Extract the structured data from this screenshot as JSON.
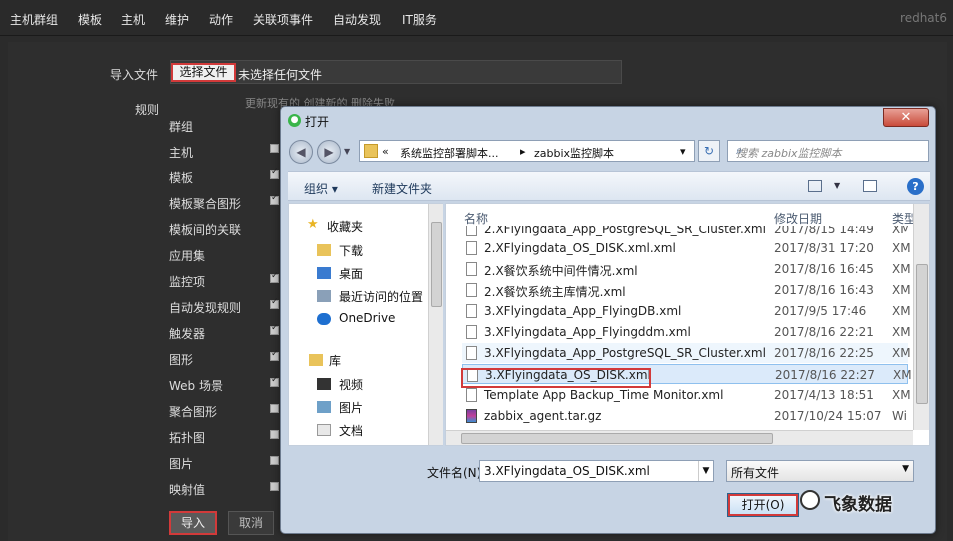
{
  "topnav": {
    "items": [
      "主机群组",
      "模板",
      "主机",
      "维护",
      "动作",
      "关联项事件",
      "自动发现",
      "IT服务"
    ],
    "user": "redhat6"
  },
  "form": {
    "import_file_label": "导入文件",
    "choose_file_button": "选择文件",
    "no_file_text": "未选择任何文件",
    "rules_label": "规则",
    "rules_header": "更新现有的 创建新的 删除失败",
    "rules": [
      {
        "label": "群组",
        "checked": false
      },
      {
        "label": "主机",
        "checked": false
      },
      {
        "label": "模板",
        "checked": true
      },
      {
        "label": "模板聚合图形",
        "checked": true
      },
      {
        "label": "模板间的关联",
        "checked": false
      },
      {
        "label": "应用集",
        "checked": false
      },
      {
        "label": "监控项",
        "checked": true
      },
      {
        "label": "自动发现规则",
        "checked": true
      },
      {
        "label": "触发器",
        "checked": true
      },
      {
        "label": "图形",
        "checked": true
      },
      {
        "label": "Web 场景",
        "checked": true
      },
      {
        "label": "聚合图形",
        "checked": false
      },
      {
        "label": "拓扑图",
        "checked": false
      },
      {
        "label": "图片",
        "checked": false
      },
      {
        "label": "映射值",
        "checked": false
      }
    ],
    "import_button": "导入",
    "cancel_button": "取消"
  },
  "dialog": {
    "title": "打开",
    "close_glyph": "✕",
    "address": {
      "prefix": "«",
      "segment1": "系统监控部署脚本...",
      "sep": "▸",
      "segment2": "zabbix监控脚本",
      "dropdown": "▾"
    },
    "search_placeholder": "搜索 zabbix监控脚本",
    "toolbar": {
      "organize": "组织 ▾",
      "new_folder": "新建文件夹"
    },
    "help_glyph": "?",
    "nav": {
      "favorites": "收藏夹",
      "items": [
        "下载",
        "桌面",
        "最近访问的位置",
        "OneDrive"
      ],
      "library": "库",
      "library_items": [
        "视频",
        "图片",
        "文档"
      ]
    },
    "columns": {
      "name": "名称",
      "modified": "修改日期",
      "type": "类型"
    },
    "files": [
      {
        "name": "2.XFlyingdata_App_PostgreSQL_SR_Cluster.xml",
        "date": "2017/8/15 14:49",
        "type": "XM"
      },
      {
        "name": "2.XFlyingdata_OS_DISK.xml.xml",
        "date": "2017/8/31 17:20",
        "type": "XM"
      },
      {
        "name": "2.X餐饮系统中间件情况.xml",
        "date": "2017/8/16 16:45",
        "type": "XM"
      },
      {
        "name": "2.X餐饮系统主库情况.xml",
        "date": "2017/8/16 16:43",
        "type": "XM"
      },
      {
        "name": "3.XFlyingdata_App_FlyingDB.xml",
        "date": "2017/9/5 17:46",
        "type": "XM"
      },
      {
        "name": "3.XFlyingdata_App_Flyingddm.xml",
        "date": "2017/8/16 22:21",
        "type": "XM"
      },
      {
        "name": "3.XFlyingdata_App_PostgreSQL_SR_Cluster.xml",
        "date": "2017/8/16 22:25",
        "type": "XM"
      },
      {
        "name": "3.XFlyingdata_OS_DISK.xml",
        "date": "2017/8/16 22:27",
        "type": "XM"
      },
      {
        "name": "Template App Backup_Time Monitor.xml",
        "date": "2017/4/13 18:51",
        "type": "XM"
      },
      {
        "name": "zabbix_agent.tar.gz",
        "date": "2017/10/24 15:07",
        "type": "Wi"
      }
    ],
    "filename_label": "文件名(N):",
    "filename_value": "3.XFlyingdata_OS_DISK.xml",
    "filetype_value": "所有文件",
    "open_button": "打开(O)"
  },
  "watermark": "飞象数据"
}
